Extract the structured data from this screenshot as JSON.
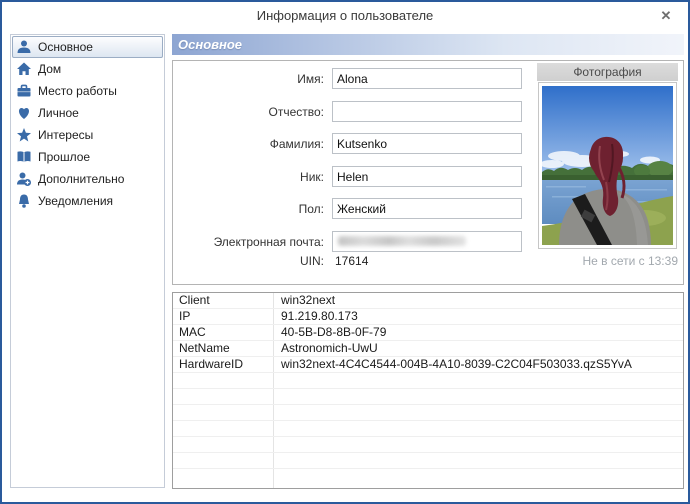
{
  "window": {
    "title": "Информация о пользователе",
    "close_glyph": "✕"
  },
  "sidebar": {
    "selected_index": 0,
    "items": [
      {
        "icon": "person-icon",
        "label": "Основное"
      },
      {
        "icon": "home-icon",
        "label": "Дом"
      },
      {
        "icon": "briefcase-icon",
        "label": "Место работы"
      },
      {
        "icon": "heart-icon",
        "label": "Личное"
      },
      {
        "icon": "star-icon",
        "label": "Интересы"
      },
      {
        "icon": "book-icon",
        "label": "Прошлое"
      },
      {
        "icon": "person-plus-icon",
        "label": "Дополнительно"
      },
      {
        "icon": "bell-icon",
        "label": "Уведомления"
      }
    ]
  },
  "main": {
    "section_header": "Основное",
    "form": {
      "fields": [
        {
          "name": "first-name",
          "label": "Имя:",
          "value": "Alona",
          "redacted": false
        },
        {
          "name": "middle-name",
          "label": "Отчество:",
          "value": "",
          "redacted": false
        },
        {
          "name": "last-name",
          "label": "Фамилия:",
          "value": "Kutsenko",
          "redacted": false
        },
        {
          "name": "nickname",
          "label": "Ник:",
          "value": "Helen",
          "redacted": false
        },
        {
          "name": "gender",
          "label": "Пол:",
          "value": "Женский",
          "redacted": false
        },
        {
          "name": "email",
          "label": "Электронная почта:",
          "value": "",
          "redacted": true
        }
      ],
      "uin_label": "UIN:",
      "uin_value": "17614"
    },
    "photo": {
      "header": "Фотография",
      "status": "Не в сети с 13:39"
    },
    "details_table": {
      "rows": [
        {
          "key": "Client",
          "value": "win32next"
        },
        {
          "key": "IP",
          "value": "91.219.80.173"
        },
        {
          "key": "MAC",
          "value": "40-5B-D8-8B-0F-79"
        },
        {
          "key": "NetName",
          "value": "Astronomich-UwU"
        },
        {
          "key": "HardwareID",
          "value": "win32next-4C4C4544-004B-4A10-8039-C2C04F503033.qzS5YvA"
        }
      ],
      "empty_row_count": 7
    }
  },
  "colors": {
    "accent_icon_blue": "#3a6ba8",
    "window_border": "#2a5a9c",
    "header_gradient_start": "#8da5d2"
  }
}
